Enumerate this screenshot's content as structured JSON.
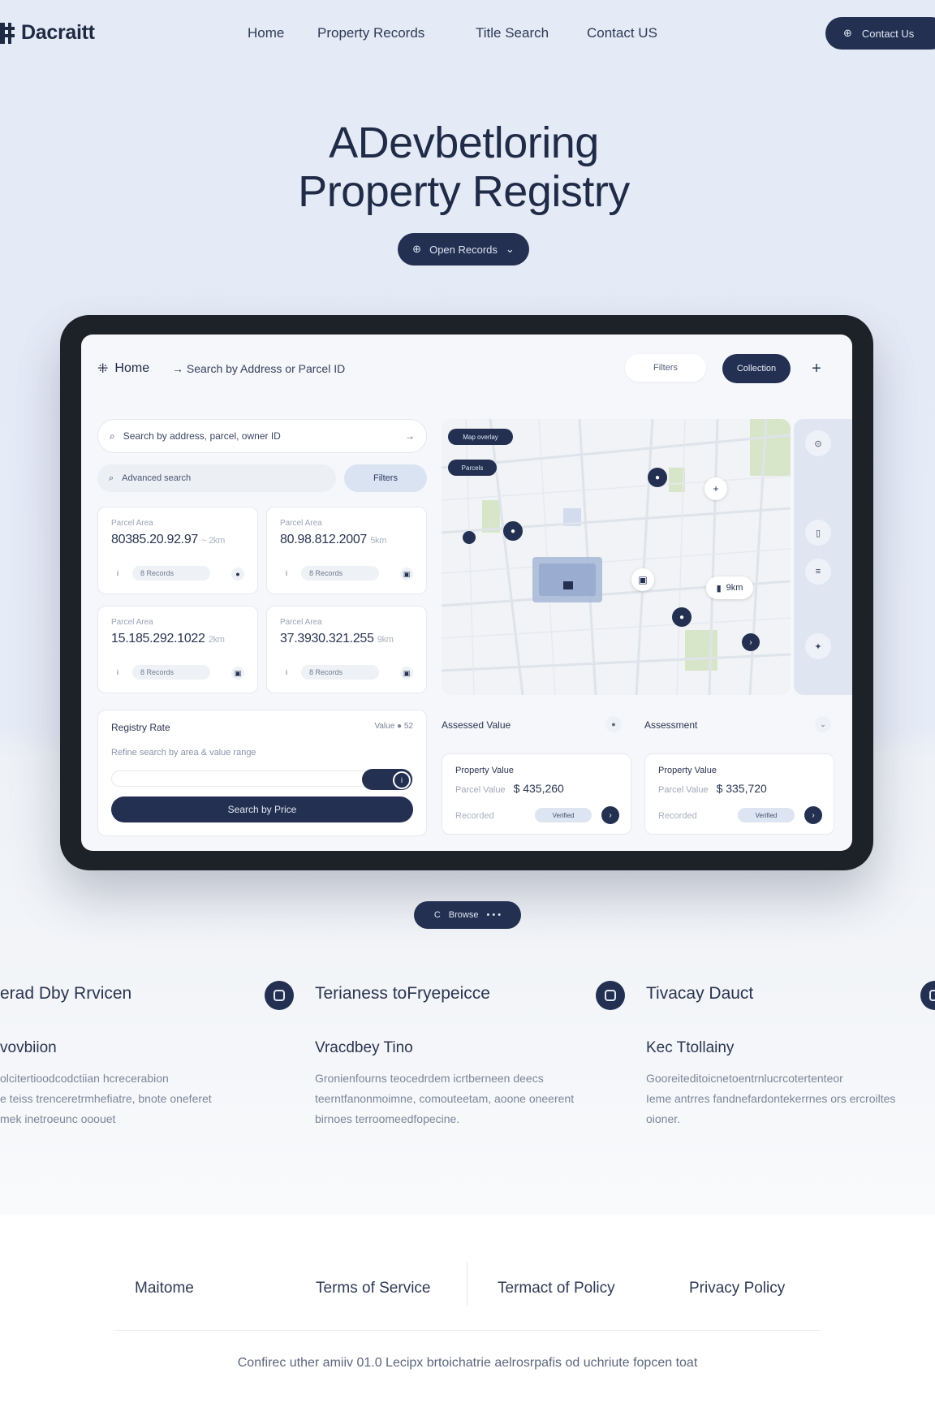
{
  "nav": {
    "brand": "Dacraitt",
    "links": [
      "Home",
      "Property Records",
      "Title Search",
      "Contact US"
    ],
    "cta": "Contact Us"
  },
  "hero": {
    "title_line1": "ADevbetloring",
    "title_line2": "Property Registry",
    "button": "Open Records"
  },
  "app": {
    "home": "Home",
    "breadcrumb": "→ Search by Address or Parcel ID",
    "filter_pill": "Filters",
    "cta": "Collection",
    "search_placeholder": "Search by address, parcel, owner ID",
    "secondary_search": "Advanced search",
    "filter_btn": "Filters",
    "cards": [
      {
        "label": "Parcel Area",
        "value": "80385.20.92.97",
        "unit": "~ 2km",
        "chip": "8 Records"
      },
      {
        "label": "Parcel Area",
        "value": "80.98.812.2007",
        "unit": "5km",
        "chip": "8 Records"
      },
      {
        "label": "Parcel Area",
        "value": "15.185.292.1022",
        "unit": "2km",
        "chip": "8 Records"
      },
      {
        "label": "Parcel Area",
        "value": "37.3930.321.255",
        "unit": "9km",
        "chip": "8 Records"
      }
    ],
    "registry": {
      "title": "Registry Rate",
      "right": "Value ● 52",
      "subtitle": "Refine search by area & value range",
      "button": "Search by Price"
    },
    "map": {
      "tag1": "Map overlay",
      "tag2": "Parcels",
      "callout": "9km"
    },
    "section_left": "Assessed Value",
    "section_right": "Assessment",
    "pcards": [
      {
        "title": "Property Value",
        "label": "Parcel Value",
        "value": "$ 435,260",
        "footer": "Recorded",
        "chip": "Verified"
      },
      {
        "title": "Property Value",
        "label": "Parcel Value",
        "value": "$ 335,720",
        "footer": "Recorded",
        "chip": "Verified"
      }
    ]
  },
  "mid_button": "Browse",
  "features": [
    {
      "title": "erad Dby Rrvicen",
      "subtitle": "vovbiion",
      "lines": [
        "olcitertioodcodctiian hcrecerabion",
        "e teiss trenceretrmhefiatre, bnote oneferet",
        "mek inetroeunc ooouet"
      ]
    },
    {
      "title": "Terianess toFryepeicce",
      "subtitle": "Vracdbey Tino",
      "lines": [
        "Gronienfourns teocedrdem icrtberneen deecs",
        "teerntfanonmoimne, comouteetam, aoone oneerent",
        "birnoes terroomeedfopecine."
      ]
    },
    {
      "title": "Tivacay Dauct",
      "subtitle": "Kec Ttollainy",
      "lines": [
        "Gooreiteditoicnetoentrnlucrcotertenteor",
        "Ieme antrres fandnefardontekerrnes ors ercroiltes",
        "oioner."
      ]
    }
  ],
  "footer": {
    "links": [
      "Maitome",
      "Terms of Service",
      "Termact of Policy",
      "Privacy Policy"
    ],
    "copyright": "Confirec uther amiiv 01.0 Lecipx brtoichatrie aelrosrpafis od uchriute fopcen toat"
  }
}
